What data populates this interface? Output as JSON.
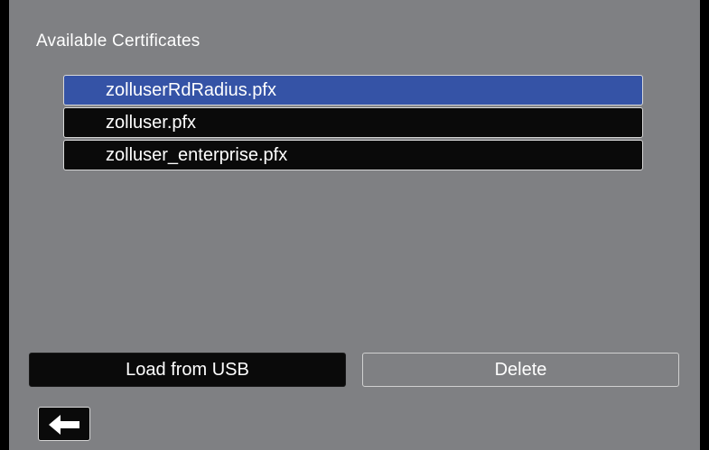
{
  "screen": {
    "title": "Available Certificates"
  },
  "certificates": [
    {
      "name": "zolluserRdRadius.pfx",
      "selected": true
    },
    {
      "name": "zolluser.pfx",
      "selected": false
    },
    {
      "name": "zolluser_enterprise.pfx",
      "selected": false
    }
  ],
  "buttons": {
    "load_label": "Load from USB",
    "delete_label": "Delete",
    "back_icon": "arrow-left-icon"
  },
  "colors": {
    "background": "#7f8083",
    "selected": "#3553a6",
    "item_background": "#0a0a0a"
  }
}
